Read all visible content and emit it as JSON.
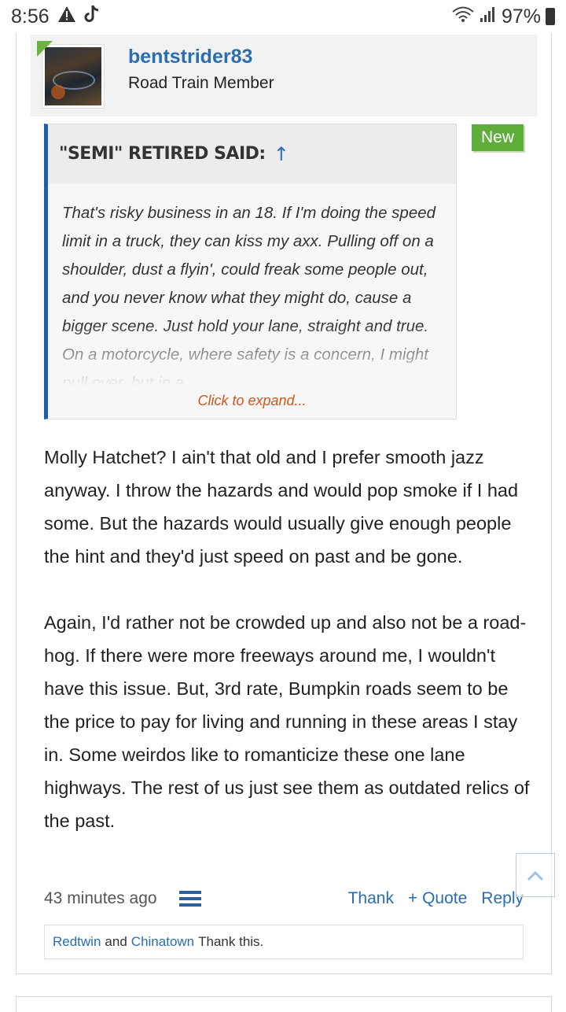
{
  "status_bar": {
    "time": "8:56",
    "left_icons": [
      "alert-icon",
      "tiktok-icon"
    ],
    "battery": "97%"
  },
  "post": {
    "username": "bentstrider83",
    "user_title": "Road Train Member",
    "new_badge": "New",
    "quote": {
      "author_header": "\"SEMI\" RETIRED SAID:",
      "arrow": "↑",
      "text": "That's risky business in an 18. If I'm doing the speed limit in a truck, they can kiss my axx. Pulling off on a shoulder, dust a flyin', could freak some people out, and you never know what they might do, cause a bigger scene. Just hold your lane, straight and true. On a motorcycle, where safety is a concern, I might pull over, but in a",
      "expand_label": "Click to expand..."
    },
    "message_paragraphs": [
      "Molly Hatchet? I ain't that old and I prefer smooth jazz anyway. I throw the hazards and would pop smoke if I had some. But the hazards would usually give enough people the hint and they'd just speed on past and be gone.",
      "Again, I'd rather not be crowded up and also not be a road-hog. If there were more freeways around me, I wouldn't have this issue. But, 3rd rate, Bumpkin roads seem to be the price to pay for living and running in these areas I stay in. Some weirdos like to romanticize these one lane highways. The rest of us just see them as outdated relics of the past."
    ],
    "timestamp": "43 minutes ago",
    "actions": {
      "thank": "Thank",
      "quote": "+ Quote",
      "reply": "Reply"
    },
    "likes": {
      "user1": "Redtwin",
      "and": "and",
      "user2": "Chinatown",
      "suffix": "Thank this."
    }
  },
  "colors": {
    "link": "#2a6db0",
    "quote_border": "#1b5fa8",
    "new_badge": "#5fae3b",
    "expand": "#d0571b"
  }
}
